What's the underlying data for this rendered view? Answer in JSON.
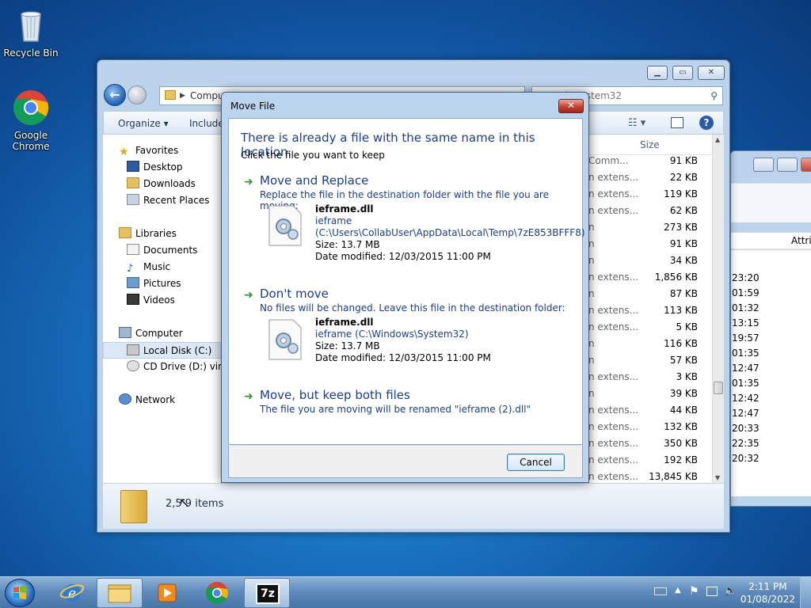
{
  "desktop": {
    "icons": [
      {
        "label": "Recycle Bin"
      },
      {
        "label": "Google Chrome"
      }
    ]
  },
  "explorer": {
    "address": "Computer ▸ Local Disk (C:) ▸ Windows ▸ System32",
    "address_visible": "Compu",
    "search_placeholder": "Search System32",
    "search_visible": "Search System32",
    "toolbar": {
      "organize": "Organize ▾",
      "include": "Include"
    },
    "column_size": "Size",
    "nav": {
      "favorites": "Favorites",
      "desktop": "Desktop",
      "downloads": "Downloads",
      "recent": "Recent Places",
      "libraries": "Libraries",
      "documents": "Documents",
      "music": "Music",
      "pictures": "Pictures",
      "videos": "Videos",
      "computer": "Computer",
      "local_disk": "Local Disk (C:)",
      "cd_drive": "CD Drive (D:) virtio",
      "network": "Network"
    },
    "rows": [
      {
        "type": "Comm...",
        "size": "91 KB"
      },
      {
        "type": "n extens...",
        "size": "22 KB"
      },
      {
        "type": "n extens...",
        "size": "119 KB"
      },
      {
        "type": "n extens...",
        "size": "62 KB"
      },
      {
        "type": "n",
        "size": "273 KB"
      },
      {
        "type": "n",
        "size": "91 KB"
      },
      {
        "type": "n",
        "size": "34 KB"
      },
      {
        "type": "n extens...",
        "size": "1,856 KB"
      },
      {
        "type": "n",
        "size": "87 KB"
      },
      {
        "type": "n extens...",
        "size": "113 KB"
      },
      {
        "type": "n extens...",
        "size": "5 KB"
      },
      {
        "type": "n",
        "size": "116 KB"
      },
      {
        "type": "n",
        "size": "57 KB"
      },
      {
        "type": "n extens...",
        "size": "3 KB"
      },
      {
        "type": "n",
        "size": "39 KB"
      },
      {
        "type": "n extens...",
        "size": "44 KB"
      },
      {
        "type": "n extens...",
        "size": "132 KB"
      },
      {
        "type": "n extens...",
        "size": "350 KB"
      },
      {
        "type": "n extens...",
        "size": "192 KB"
      },
      {
        "type": "n extens...",
        "size": "13,845 KB"
      }
    ],
    "item_count": "2,5  9 items"
  },
  "back_window": {
    "column": "Attril",
    "times": [
      "23:20",
      "01:59",
      "01:32",
      "13:15",
      "19:57",
      "01:35",
      "12:47",
      "01:35",
      "12:42",
      "12:47",
      "20:33",
      "22:35",
      "20:32"
    ]
  },
  "dialog": {
    "title": "Move File",
    "heading": "There is already a file with the same name in this location.",
    "subheading": "Click the file you want to keep",
    "replace": {
      "title": "Move and Replace",
      "desc": "Replace the file in the destination folder with the file you are moving:",
      "file_name": "ieframe.dll",
      "file_desc": "ieframe",
      "file_path": "(C:\\Users\\CollabUser\\AppData\\Local\\Temp\\7zE853BFFF8)",
      "size": "Size: 13.7 MB",
      "modified": "Date modified: 12/03/2015 11:00 PM"
    },
    "dont_move": {
      "title": "Don't move",
      "desc": "No files will be changed. Leave this file in the destination folder:",
      "file_name": "ieframe.dll",
      "file_path": "ieframe (C:\\Windows\\System32)",
      "size": "Size: 13.7 MB",
      "modified": "Date modified: 12/03/2015 11:00 PM"
    },
    "keep_both": {
      "title": "Move, but keep both files",
      "desc": "The file you are moving will be renamed \"ieframe (2).dll\""
    },
    "cancel": "Cancel"
  },
  "taskbar": {
    "time": "2:11 PM",
    "date": "01/08/2022",
    "app_7z": "7z"
  }
}
